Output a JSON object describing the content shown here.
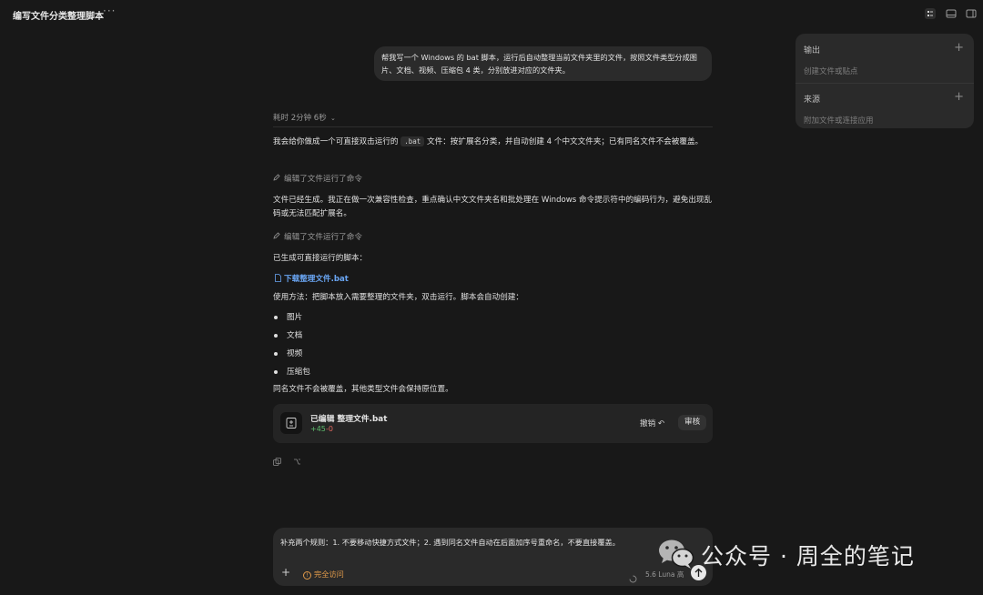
{
  "window": {
    "title": "编写文件分类整理脚本",
    "more": "···"
  },
  "side_panel": {
    "output": {
      "title": "输出",
      "sub": "创建文件或贴点"
    },
    "source": {
      "title": "来源",
      "sub": "附加文件或连接应用"
    },
    "plus": "+"
  },
  "user_message": "帮我写一个 Windows 的 bat 脚本，运行后自动整理当前文件夹里的文件，按照文件类型分成图片、文档、视频、压缩包 4 类，分别放进对应的文件夹。",
  "assistant": {
    "duration": "耗时 2分钟 6秒",
    "para1_a": "我会给你做成一个可直接双击运行的 ",
    "para1_code": ".bat",
    "para1_b": " 文件：按扩展名分类，并自动创建 4 个中文文件夹；已有同名文件不会被覆盖。",
    "tool1": "编辑了文件运行了命令",
    "para2": "文件已经生成。我正在做一次兼容性检查，重点确认中文文件夹名和批处理在 Windows 命令提示符中的编码行为，避免出现乱码或无法匹配扩展名。",
    "tool2": "编辑了文件运行了命令",
    "para3": "已生成可直接运行的脚本：",
    "file_link": "下载整理文件.bat",
    "para4": "使用方法：把脚本放入需要整理的文件夹，双击运行。脚本会自动创建：",
    "bullets": [
      "图片",
      "文档",
      "视频",
      "压缩包"
    ],
    "para5": "同名文件不会被覆盖，其他类型文件会保持原位置。"
  },
  "edit_card": {
    "title": "已编辑 整理文件.bat",
    "added": "+45",
    "removed": "-0",
    "undo": "撤销 ↶",
    "review": "审核"
  },
  "composer": {
    "text": "补充两个规则：1. 不要移动快捷方式文件；2. 遇到同名文件自动在后面加序号重命名，不要直接覆盖。",
    "plus": "+",
    "access": "完全访问",
    "model": "5.6 Luna 高"
  },
  "watermark": "公众号 · 周全的笔记",
  "colors": {
    "background": "#181818",
    "link": "#6aa6f4",
    "added": "#5fbf6e",
    "removed": "#e0685f",
    "access": "#e09a4a",
    "watermark_logo": "#b4b4b4"
  }
}
